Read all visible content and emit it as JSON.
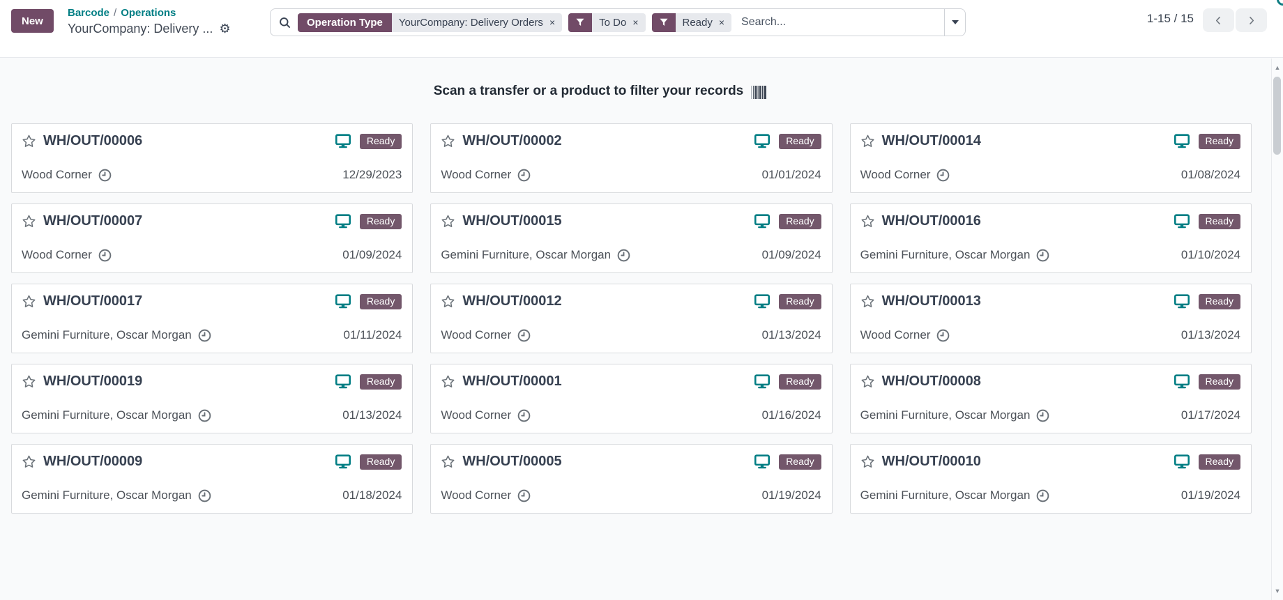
{
  "header": {
    "new_button_label": "New",
    "breadcrumb": {
      "links": [
        "Barcode",
        "Operations"
      ],
      "separator": "/",
      "active": "YourCompany: Delivery ..."
    },
    "search": {
      "facet_operation_type": {
        "label": "Operation Type",
        "value": "YourCompany: Delivery Orders"
      },
      "facet_todo": {
        "label": "To Do"
      },
      "facet_ready": {
        "label": "Ready"
      },
      "placeholder": "Search..."
    },
    "pager": {
      "range": "1-15 / 15"
    }
  },
  "banner": {
    "message": "Scan a transfer or a product to filter your records"
  },
  "status_colors": {
    "ready_badge": "#73576b",
    "accent": "#714B67",
    "teal": "#017e84"
  },
  "icons": {
    "close": "×",
    "gear": "⚙",
    "scroll_up": "▲",
    "scroll_down": "▼"
  },
  "cards": [
    {
      "ref": "WH/OUT/00006",
      "partner": "Wood Corner",
      "status": "Ready",
      "date": "12/29/2023"
    },
    {
      "ref": "WH/OUT/00002",
      "partner": "Wood Corner",
      "status": "Ready",
      "date": "01/01/2024"
    },
    {
      "ref": "WH/OUT/00014",
      "partner": "Wood Corner",
      "status": "Ready",
      "date": "01/08/2024"
    },
    {
      "ref": "WH/OUT/00007",
      "partner": "Wood Corner",
      "status": "Ready",
      "date": "01/09/2024"
    },
    {
      "ref": "WH/OUT/00015",
      "partner": "Gemini Furniture, Oscar Morgan",
      "status": "Ready",
      "date": "01/09/2024"
    },
    {
      "ref": "WH/OUT/00016",
      "partner": "Gemini Furniture, Oscar Morgan",
      "status": "Ready",
      "date": "01/10/2024"
    },
    {
      "ref": "WH/OUT/00017",
      "partner": "Gemini Furniture, Oscar Morgan",
      "status": "Ready",
      "date": "01/11/2024"
    },
    {
      "ref": "WH/OUT/00012",
      "partner": "Wood Corner",
      "status": "Ready",
      "date": "01/13/2024"
    },
    {
      "ref": "WH/OUT/00013",
      "partner": "Wood Corner",
      "status": "Ready",
      "date": "01/13/2024"
    },
    {
      "ref": "WH/OUT/00019",
      "partner": "Gemini Furniture, Oscar Morgan",
      "status": "Ready",
      "date": "01/13/2024"
    },
    {
      "ref": "WH/OUT/00001",
      "partner": "Wood Corner",
      "status": "Ready",
      "date": "01/16/2024"
    },
    {
      "ref": "WH/OUT/00008",
      "partner": "Gemini Furniture, Oscar Morgan",
      "status": "Ready",
      "date": "01/17/2024"
    },
    {
      "ref": "WH/OUT/00009",
      "partner": "Gemini Furniture, Oscar Morgan",
      "status": "Ready",
      "date": "01/18/2024"
    },
    {
      "ref": "WH/OUT/00005",
      "partner": "Wood Corner",
      "status": "Ready",
      "date": "01/19/2024"
    },
    {
      "ref": "WH/OUT/00010",
      "partner": "Gemini Furniture, Oscar Morgan",
      "status": "Ready",
      "date": "01/19/2024"
    }
  ]
}
